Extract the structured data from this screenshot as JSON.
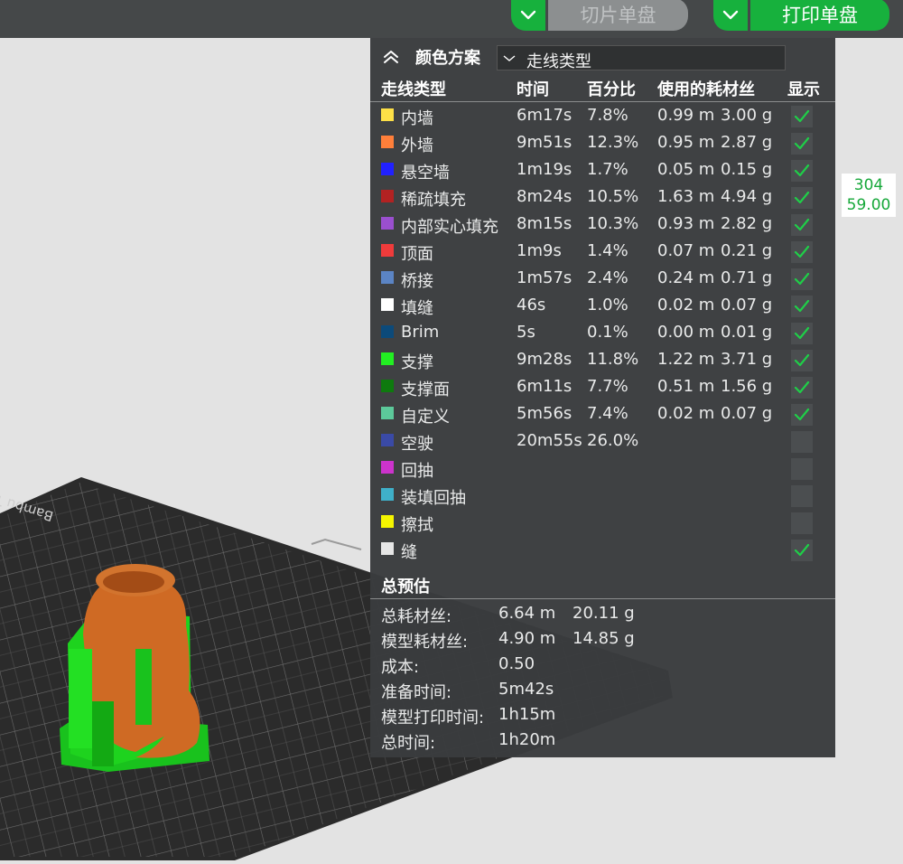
{
  "toolbar": {
    "slice_label": "切片单盘",
    "print_label": "打印单盘",
    "accent": "#17b13d"
  },
  "panel": {
    "title": "颜色方案",
    "scheme_value": "走线类型",
    "headers": [
      "走线类型",
      "时间",
      "百分比",
      "使用的耗材丝",
      "显示"
    ],
    "rows": [
      {
        "color": "#fde047",
        "name": "内墙",
        "time": "6m17s",
        "pct": "7.8%",
        "len": "0.99 m",
        "weight": "3.00 g",
        "shown": true
      },
      {
        "color": "#ff7f3a",
        "name": "外墙",
        "time": "9m51s",
        "pct": "12.3%",
        "len": "0.95 m",
        "weight": "2.87 g",
        "shown": true
      },
      {
        "color": "#2121ff",
        "name": "悬空墙",
        "time": "1m19s",
        "pct": "1.7%",
        "len": "0.05 m",
        "weight": "0.15 g",
        "shown": true
      },
      {
        "color": "#b22222",
        "name": "稀疏填充",
        "time": "8m24s",
        "pct": "10.5%",
        "len": "1.63 m",
        "weight": "4.94 g",
        "shown": true
      },
      {
        "color": "#9a4fcf",
        "name": "内部实心填充",
        "time": "8m15s",
        "pct": "10.3%",
        "len": "0.93 m",
        "weight": "2.82 g",
        "shown": true
      },
      {
        "color": "#ef3b3b",
        "name": "顶面",
        "time": "1m9s",
        "pct": "1.4%",
        "len": "0.07 m",
        "weight": "0.21 g",
        "shown": true
      },
      {
        "color": "#5b84c4",
        "name": "桥接",
        "time": "1m57s",
        "pct": "2.4%",
        "len": "0.24 m",
        "weight": "0.71 g",
        "shown": true
      },
      {
        "color": "#ffffff",
        "name": "填缝",
        "time": "46s",
        "pct": "1.0%",
        "len": "0.02 m",
        "weight": "0.07 g",
        "shown": true
      },
      {
        "color": "#0c4a7a",
        "name": "Brim",
        "time": "5s",
        "pct": "0.1%",
        "len": "0.00 m",
        "weight": "0.01 g",
        "shown": true
      },
      {
        "color": "#22ee22",
        "name": "支撑",
        "time": "9m28s",
        "pct": "11.8%",
        "len": "1.22 m",
        "weight": "3.71 g",
        "shown": true
      },
      {
        "color": "#0e7a0e",
        "name": "支撑面",
        "time": "6m11s",
        "pct": "7.7%",
        "len": "0.51 m",
        "weight": "1.56 g",
        "shown": true
      },
      {
        "color": "#5cc99a",
        "name": "自定义",
        "time": "5m56s",
        "pct": "7.4%",
        "len": "0.02 m",
        "weight": "0.07 g",
        "shown": true
      },
      {
        "color": "#3a4aa6",
        "name": "空驶",
        "time": "20m55s",
        "pct": "26.0%",
        "len": "",
        "weight": "",
        "shown": false
      },
      {
        "color": "#cc33cc",
        "name": "回抽",
        "time": "",
        "pct": "",
        "len": "",
        "weight": "",
        "shown": false
      },
      {
        "color": "#3fb0c9",
        "name": "装填回抽",
        "time": "",
        "pct": "",
        "len": "",
        "weight": "",
        "shown": false
      },
      {
        "color": "#f5f500",
        "name": "擦拭",
        "time": "",
        "pct": "",
        "len": "",
        "weight": "",
        "shown": false
      },
      {
        "color": "#e6e6e6",
        "name": "缝",
        "time": "",
        "pct": "",
        "len": "",
        "weight": "",
        "shown": true
      }
    ],
    "summary_title": "总预估",
    "summary": [
      {
        "label": "总耗材丝:",
        "v1": "6.64 m",
        "v2": "20.11 g"
      },
      {
        "label": "模型耗材丝:",
        "v1": "4.90 m",
        "v2": "14.85 g"
      },
      {
        "label": "成本:",
        "v1": "0.50",
        "v2": ""
      },
      {
        "label": "准备时间:",
        "v1": "5m42s",
        "v2": ""
      },
      {
        "label": "模型打印时间:",
        "v1": "1h15m",
        "v2": ""
      },
      {
        "label": "总时间:",
        "v1": "1h20m",
        "v2": ""
      }
    ]
  },
  "layer_tooltip": {
    "layer": "304",
    "height": "59.00"
  },
  "viewport": {
    "bed_label": "Bambu Text"
  }
}
